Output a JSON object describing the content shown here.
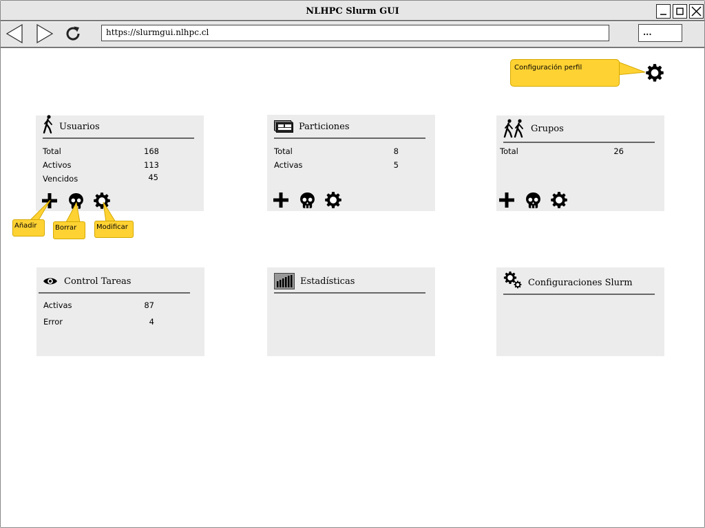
{
  "window": {
    "title": "NLHPC Slurm GUI"
  },
  "browser": {
    "url": "https://slurmgui.nlhpc.cl",
    "menu_label": "..."
  },
  "profile": {
    "callout": "Configuración perfil"
  },
  "cards": {
    "usuarios": {
      "title": "Usuarios",
      "rows": [
        {
          "label": "Total",
          "value": "168"
        },
        {
          "label": "Activos",
          "value": "113"
        },
        {
          "label": "Vencidos",
          "value": "45"
        }
      ],
      "tips": {
        "add": "Añadir",
        "delete": "Borrar",
        "modify": "Modificar"
      }
    },
    "particiones": {
      "title": "Particiones",
      "rows": [
        {
          "label": "Total",
          "value": "8"
        },
        {
          "label": "Activas",
          "value": "5"
        }
      ]
    },
    "grupos": {
      "title": "Grupos",
      "rows": [
        {
          "label": "Total",
          "value": "26"
        }
      ]
    },
    "control": {
      "title": "Control Tareas",
      "rows": [
        {
          "label": "Activas",
          "value": "87"
        },
        {
          "label": "Error",
          "value": "4"
        }
      ]
    },
    "estadisticas": {
      "title": "Estadísticas"
    },
    "config": {
      "title": "Configuraciones Slurm"
    }
  },
  "icons": {
    "window": [
      "minimize-icon",
      "maximize-icon",
      "close-icon"
    ],
    "nav": [
      "back-arrow-icon",
      "forward-arrow-icon",
      "reload-icon"
    ],
    "actions": [
      "plus-icon",
      "skull-icon",
      "gear-icon"
    ],
    "cards": [
      "walking-person-icon",
      "partitions-icon",
      "group-walking-icon",
      "eye-icon",
      "bar-chart-icon",
      "gears-icon"
    ]
  },
  "colors": {
    "callout": "#ffd233",
    "card_bg": "#ececec",
    "chrome_bg": "#e6e6e6"
  }
}
